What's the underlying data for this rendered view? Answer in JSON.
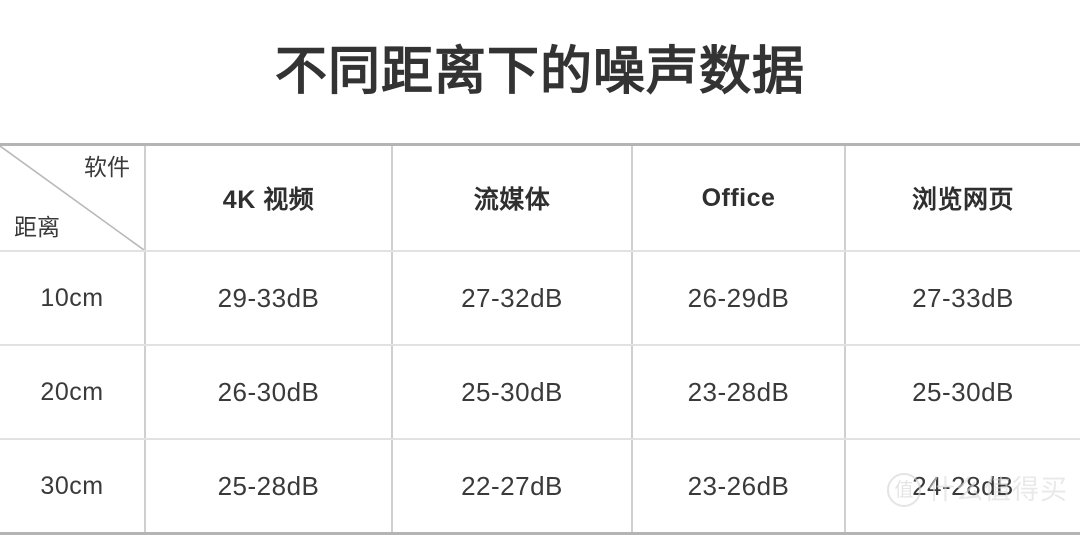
{
  "title": "不同距离下的噪声数据",
  "table": {
    "corner": {
      "top_right_label": "软件",
      "bottom_left_label": "距离"
    },
    "columns": [
      "4K 视频",
      "流媒体",
      "Office",
      "浏览网页"
    ],
    "rows": [
      {
        "distance": "10cm",
        "values": [
          "29-33dB",
          "27-32dB",
          "26-29dB",
          "27-33dB"
        ]
      },
      {
        "distance": "20cm",
        "values": [
          "26-30dB",
          "25-30dB",
          "23-28dB",
          "25-30dB"
        ]
      },
      {
        "distance": "30cm",
        "values": [
          "25-28dB",
          "22-27dB",
          "23-26dB",
          "24-28dB"
        ]
      }
    ]
  },
  "watermark": {
    "mark": "值",
    "text": "什么值得买"
  },
  "colors": {
    "title": "#333333",
    "text": "#3a3a3a",
    "border_outer": "#b4b4b4",
    "border_inner": "#cfcfcf",
    "background": "#ffffff",
    "watermark": "#dcdcdc"
  },
  "chart_data": {
    "type": "table",
    "title": "不同距离下的噪声数据",
    "row_header": "距离",
    "column_header": "软件",
    "columns": [
      "4K 视频",
      "流媒体",
      "Office",
      "浏览网页"
    ],
    "rows": [
      "10cm",
      "20cm",
      "30cm"
    ],
    "unit": "dB",
    "cells": [
      [
        "29-33dB",
        "27-32dB",
        "26-29dB",
        "27-33dB"
      ],
      [
        "26-30dB",
        "25-30dB",
        "23-28dB",
        "25-30dB"
      ],
      [
        "25-28dB",
        "22-27dB",
        "23-26dB",
        "24-28dB"
      ]
    ],
    "ranges": [
      [
        [
          29,
          33
        ],
        [
          27,
          32
        ],
        [
          26,
          29
        ],
        [
          27,
          33
        ]
      ],
      [
        [
          26,
          30
        ],
        [
          25,
          30
        ],
        [
          23,
          28
        ],
        [
          25,
          30
        ]
      ],
      [
        [
          25,
          28
        ],
        [
          22,
          27
        ],
        [
          23,
          26
        ],
        [
          24,
          28
        ]
      ]
    ]
  }
}
